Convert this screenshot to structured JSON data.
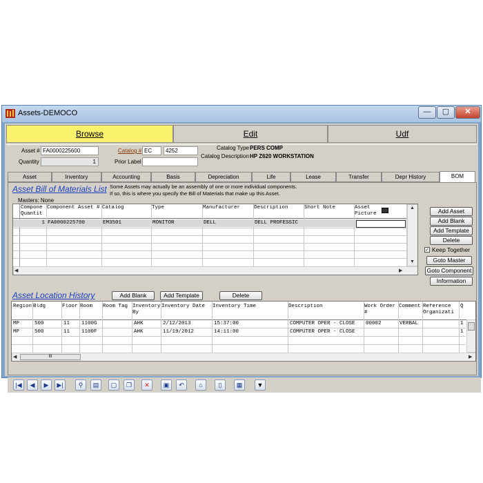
{
  "window": {
    "title": "Assets-DEMOCO",
    "minimize": "—",
    "maximize": "▢",
    "close": "✕"
  },
  "main_tabs": [
    {
      "label": "Browse"
    },
    {
      "label": "Edit"
    },
    {
      "label": "Udf"
    }
  ],
  "header": {
    "asset_label": "Asset #",
    "asset_value": "FA0000225600",
    "quantity_label": "Quantity",
    "quantity_value": "1",
    "catalog_label": "Catalog #",
    "catalog_prefix": "EC",
    "catalog_value": "4252",
    "prior_label": "Prior Label",
    "prior_value": "",
    "catalog_type_label": "Catalog Type",
    "catalog_type_value": "PERS COMP",
    "catalog_desc_label": "Catalog Description",
    "catalog_desc_value": "HP Z620 WORKSTATION"
  },
  "sub_tabs": [
    "Asset",
    "Inventory",
    "Accounting",
    "Basis",
    "Depreciation",
    "Life",
    "Lease",
    "Transfer",
    "Depr History",
    "BOM"
  ],
  "bom": {
    "title": "Asset Bill of Materials List",
    "note_line1": "Some Assets may actually be an assembly of one or more individual components.",
    "note_line2": "If so, this is where you specify the Bill of Materials that make up this Asset.",
    "masters": "Masters: None",
    "columns": [
      "Compone Quantit",
      "Component Asset #",
      "Catalog",
      "Type",
      "Manufacturer",
      "Description",
      "Short Note",
      "Asset Picture"
    ],
    "rows": [
      {
        "qty": "1",
        "component": "FA0000225700",
        "catalog": "EM3501",
        "type": "MONITOR",
        "manufacturer": "DELL",
        "description": "DELL PROFESSIC",
        "short_note": "",
        "picture": ""
      }
    ],
    "buttons": {
      "add_asset": "Add Asset",
      "add_blank": "Add Blank",
      "add_template": "Add Template",
      "delete": "Delete",
      "keep_together": "Keep Together",
      "keep_together_checked": true,
      "goto_master": "Goto Master",
      "goto_component": "Goto Component",
      "information": "Information"
    }
  },
  "location": {
    "title": "Asset Location History",
    "add_blank": "Add Blank",
    "add_template": "Add Template",
    "delete": "Delete",
    "columns": [
      "Region",
      "Bldg",
      "Floor",
      "Room",
      "Room Tag",
      "Inventory By",
      "Inventory Date",
      "Inventory Time",
      "Description",
      "Work Order #",
      "Comment",
      "Reference Organizati",
      "Q"
    ],
    "rows": [
      {
        "region": "MP",
        "bldg": "500",
        "floor": "11",
        "room": "1100G",
        "tag": "",
        "by": "AHK",
        "date": "2/12/2013",
        "time": "15:37:00",
        "desc": "COMPUTER OPER - CLOSE",
        "wo": "00002",
        "comment": "VERBAL",
        "ref": "",
        "q": "1"
      },
      {
        "region": "MP",
        "bldg": "500",
        "floor": "11",
        "room": "1100F",
        "tag": "",
        "by": "AHK",
        "date": "11/19/2012",
        "time": "14:11:00",
        "desc": "COMPUTER OPER - CLOSE",
        "wo": "",
        "comment": "",
        "ref": "",
        "q": "1"
      }
    ],
    "hscroll_grip": "III"
  },
  "toolbar_icons": [
    "first-record-icon",
    "prev-record-icon",
    "next-record-icon",
    "last-record-icon",
    "find-icon",
    "report-icon",
    "new-record-icon",
    "copy-record-icon",
    "delete-record-icon",
    "save-icon",
    "undo-icon",
    "home-icon",
    "attach-icon",
    "export-icon",
    "dropdown-menu-icon"
  ],
  "toolbar_glyphs": [
    "|◀",
    "◀",
    "▶",
    "▶|",
    "⚲",
    "▤",
    "▢",
    "❐",
    "✕",
    "▣",
    "↶",
    "⌂",
    "▯",
    "▦",
    "▼"
  ],
  "colors": {
    "browse_tab": "#fbf26c",
    "link": "#1a3fbf",
    "window_frame": "#7fa4cc"
  }
}
